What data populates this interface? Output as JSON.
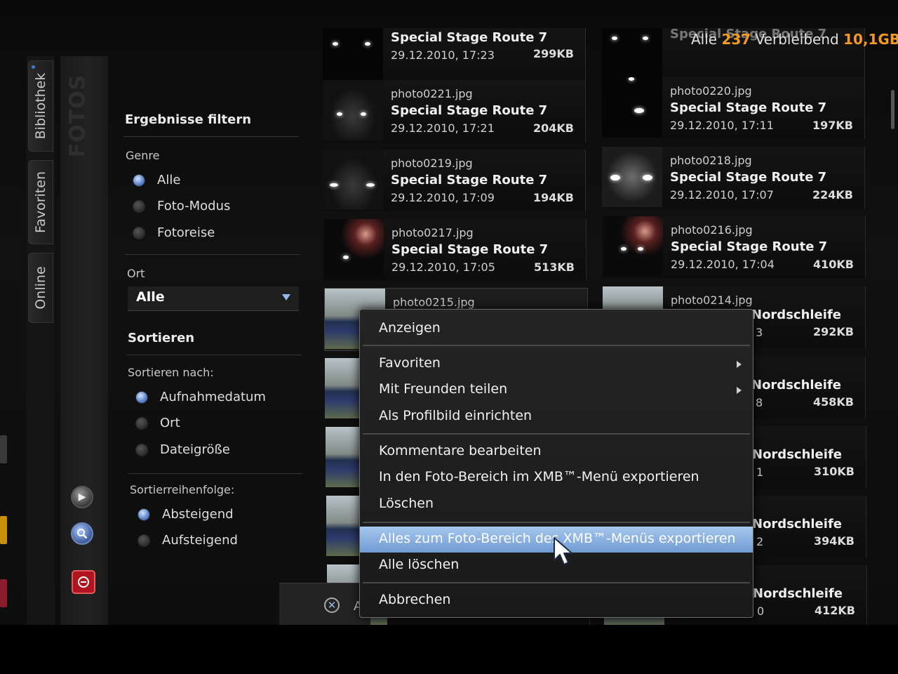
{
  "header": {
    "filter_label": "Alle",
    "count": "237",
    "remaining_label": "Verbleibend",
    "remaining_value": "10,1GB",
    "accent_color": "#f59a1f"
  },
  "tabs": [
    {
      "label": "Bibliothek"
    },
    {
      "label": "Favoriten"
    },
    {
      "label": "Online"
    }
  ],
  "section_title": "FOTOS",
  "filter": {
    "title": "Ergebnisse filtern",
    "genre_label": "Genre",
    "genre_options": [
      "Alle",
      "Foto-Modus",
      "Fotoreise"
    ],
    "genre_selected": "Alle",
    "ort_label": "Ort",
    "ort_value": "Alle",
    "sort_title": "Sortieren",
    "sort_by_label": "Sortieren nach:",
    "sort_by_options": [
      "Aufnahmedatum",
      "Ort",
      "Dateigröße"
    ],
    "sort_order_label": "Sortierreihenfolge:",
    "sort_order_options": [
      "Absteigend",
      "Aufsteigend"
    ]
  },
  "photos": [
    {
      "file": "",
      "title": "Special Stage Route 7",
      "date": "29.12.2010, 17:23",
      "size": "299KB"
    },
    {
      "file": "",
      "title": "Special Stage Route 7",
      "date": "",
      "size": ""
    },
    {
      "file": "photo0221.jpg",
      "title": "Special Stage Route 7",
      "date": "29.12.2010, 17:21",
      "size": "204KB"
    },
    {
      "file": "photo0220.jpg",
      "title": "Special Stage Route 7",
      "date": "29.12.2010, 17:11",
      "size": "197KB"
    },
    {
      "file": "photo0219.jpg",
      "title": "Special Stage Route 7",
      "date": "29.12.2010, 17:09",
      "size": "194KB"
    },
    {
      "file": "photo0218.jpg",
      "title": "Special Stage Route 7",
      "date": "29.12.2010, 17:07",
      "size": "224KB"
    },
    {
      "file": "photo0217.jpg",
      "title": "Special Stage Route 7",
      "date": "29.12.2010, 17:05",
      "size": "513KB"
    },
    {
      "file": "photo0216.jpg",
      "title": "Special Stage Route 7",
      "date": "29.12.2010, 17:04",
      "size": "410KB"
    },
    {
      "file": "photo0215.jpg",
      "title": "",
      "date": "",
      "size": ""
    },
    {
      "file": "photo0214.jpg",
      "title": "Nordschleife",
      "date": "3",
      "size": "292KB"
    },
    {
      "file": "",
      "title": "Nordschleife",
      "date": "8",
      "size": "458KB"
    },
    {
      "file": "",
      "title": "Nordschleife",
      "date": "1",
      "size": "310KB"
    },
    {
      "file": "",
      "title": "Nordschleife",
      "date": "2",
      "size": "394KB"
    },
    {
      "file": "",
      "title": "Nordschleife",
      "date": "0",
      "size": "412KB"
    }
  ],
  "context_menu": {
    "items": [
      {
        "label": "Anzeigen"
      },
      {
        "label": "Favoriten"
      },
      {
        "label": "Mit Freunden teilen"
      },
      {
        "label": "Als Profilbild einrichten"
      },
      {
        "label": "Kommentare bearbeiten"
      },
      {
        "label": "In den Foto-Bereich im XMB™-Menü exportieren"
      },
      {
        "label": "Löschen"
      },
      {
        "label": "Alles zum Foto-Bereich des XMB™-Menüs exportieren"
      },
      {
        "label": "Alle löschen"
      },
      {
        "label": "Abbrechen"
      }
    ],
    "highlighted": "Alles zum Foto-Bereich des XMB™-Menüs exportieren"
  },
  "hint_bar": {
    "text": "A"
  }
}
